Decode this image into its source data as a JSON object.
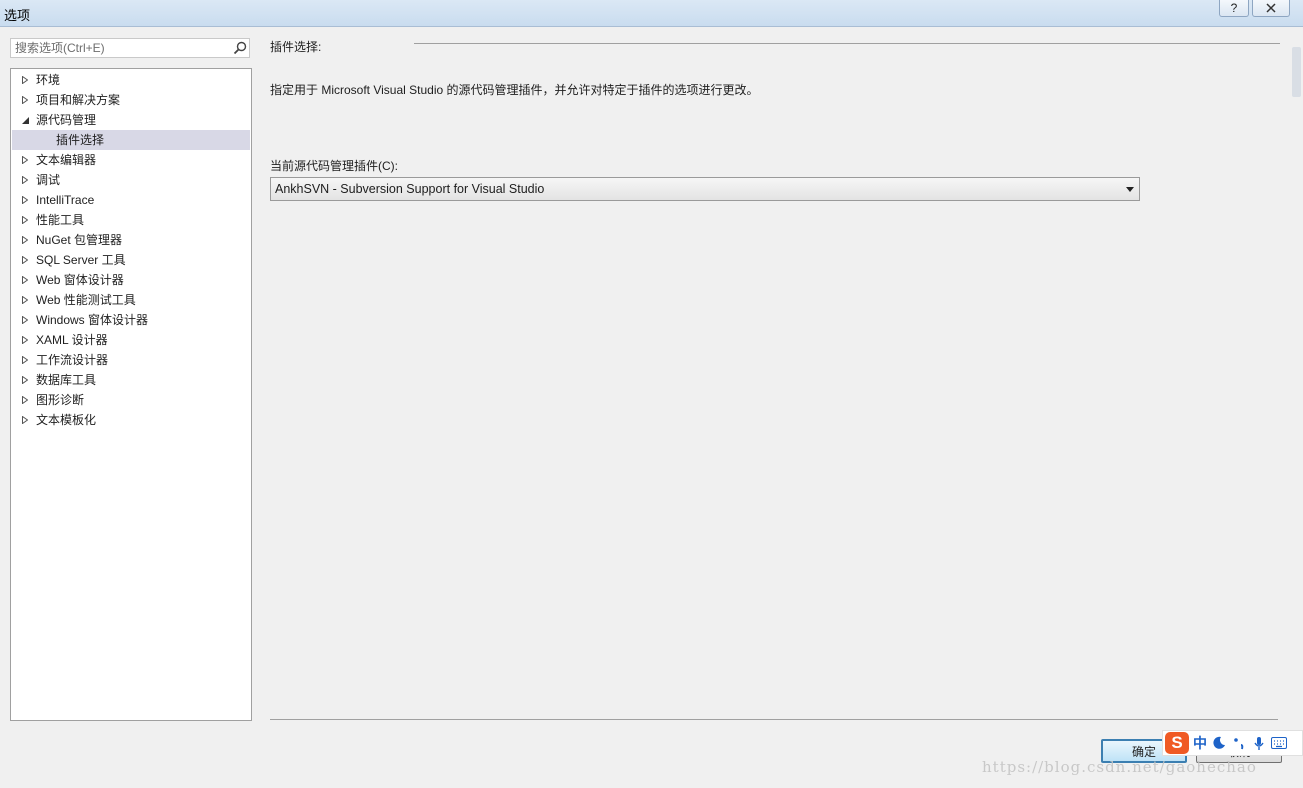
{
  "window": {
    "title": "选项",
    "help_label": "?"
  },
  "search": {
    "placeholder": "搜索选项(Ctrl+E)"
  },
  "tree": {
    "items": [
      {
        "label": "环境",
        "expanded": false
      },
      {
        "label": "项目和解决方案",
        "expanded": false
      },
      {
        "label": "源代码管理",
        "expanded": true
      },
      {
        "label": "插件选择",
        "child": true,
        "selected": true
      },
      {
        "label": "文本编辑器",
        "expanded": false
      },
      {
        "label": "调试",
        "expanded": false
      },
      {
        "label": "IntelliTrace",
        "expanded": false
      },
      {
        "label": "性能工具",
        "expanded": false
      },
      {
        "label": "NuGet 包管理器",
        "expanded": false
      },
      {
        "label": "SQL Server 工具",
        "expanded": false
      },
      {
        "label": "Web 窗体设计器",
        "expanded": false
      },
      {
        "label": "Web 性能测试工具",
        "expanded": false
      },
      {
        "label": "Windows 窗体设计器",
        "expanded": false
      },
      {
        "label": "XAML 设计器",
        "expanded": false
      },
      {
        "label": "工作流设计器",
        "expanded": false
      },
      {
        "label": "数据库工具",
        "expanded": false
      },
      {
        "label": "图形诊断",
        "expanded": false
      },
      {
        "label": "文本模板化",
        "expanded": false
      }
    ]
  },
  "main": {
    "section_title": "插件选择:",
    "description": "指定用于 Microsoft Visual Studio 的源代码管理插件，并允许对特定于插件的选项进行更改。",
    "plugin_label": "当前源代码管理插件(C):",
    "plugin_value": "AnkhSVN - Subversion Support for Visual Studio"
  },
  "buttons": {
    "ok": "确定",
    "cancel": "取消"
  },
  "ime": {
    "mode": "中"
  },
  "watermark": "https://blog.csdn.net/gaohechao",
  "colors": {
    "selected_bg": "#d8d8e6",
    "ok_border": "#3c7fb1",
    "ime_logo": "#f05a24"
  }
}
